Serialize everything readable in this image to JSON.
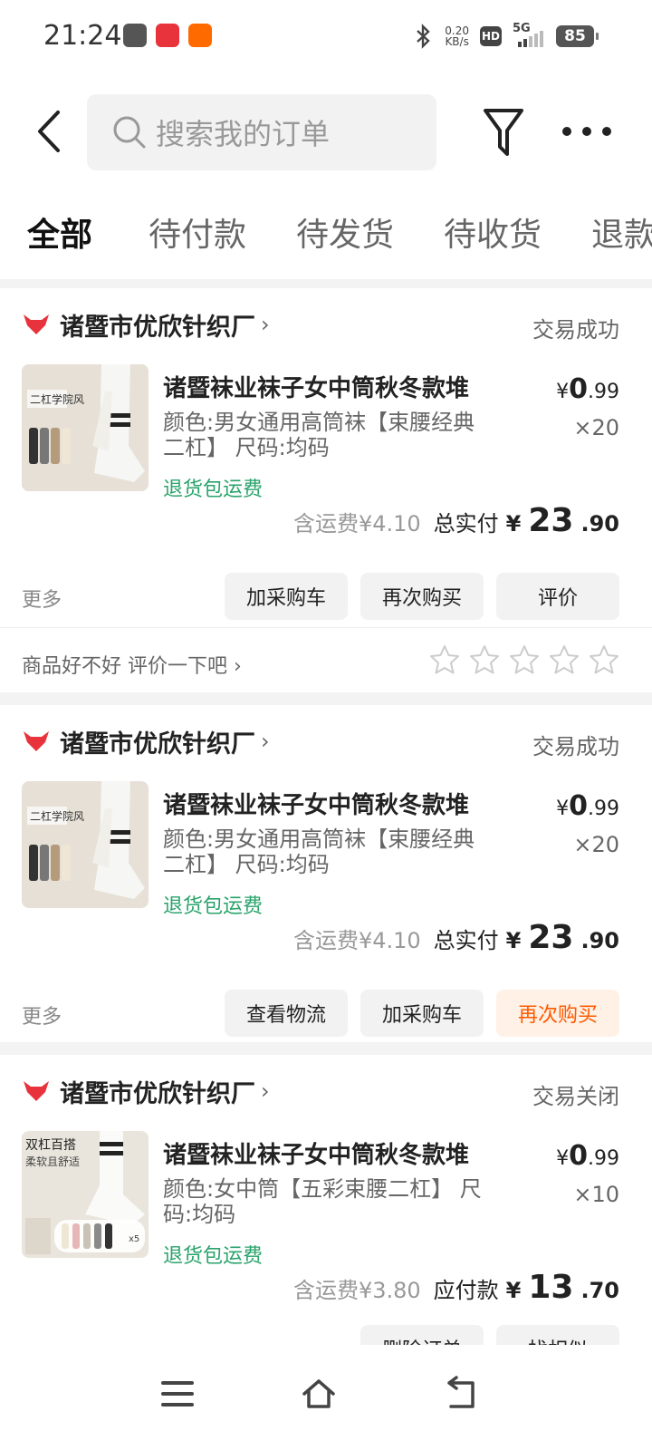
{
  "status_bar": {
    "time": "21:24",
    "net_speed_value": "0.20",
    "net_speed_unit": "KB/s",
    "hd": "HD",
    "network": "5G",
    "battery": "85",
    "colors": {
      "app1": "#555555",
      "app2": "#e8323c",
      "app3": "#ff6a00"
    }
  },
  "header": {
    "search_placeholder": "搜索我的订单",
    "icons": {
      "back": "chevron-left-icon",
      "search": "search-icon",
      "filter": "filter-icon",
      "more": "more-dots-icon"
    }
  },
  "tabs": [
    {
      "label": "全部",
      "active": true
    },
    {
      "label": "待付款"
    },
    {
      "label": "待发货"
    },
    {
      "label": "待收货"
    },
    {
      "label": "退款"
    }
  ],
  "orders": [
    {
      "shop": "诸暨市优欣针织厂",
      "status": "交易成功",
      "title": "诸暨袜业袜子女中筒秋冬款堆",
      "spec": "颜色:男女通用高筒袜【束腰经典二杠】 尺码:均码",
      "free_return": "退货包运费",
      "price_symbol": "¥",
      "price_int": "0",
      "price_dec": ".99",
      "qty": "×20",
      "shipping": "含运费¥4.10",
      "total_label": "总实付",
      "total_symbol": "¥",
      "total_int": "23",
      "total_dec": ".90",
      "more": "更多",
      "buttons": [
        "加采购车",
        "再次购买",
        "评价"
      ],
      "rate_text": "商品好不好 评价一下吧",
      "stars_selected": 0,
      "stars_total": 5,
      "thumb_text": "二杠学院风"
    },
    {
      "shop": "诸暨市优欣针织厂",
      "status": "交易成功",
      "title": "诸暨袜业袜子女中筒秋冬款堆",
      "spec": "颜色:男女通用高筒袜【束腰经典二杠】 尺码:均码",
      "free_return": "退货包运费",
      "price_symbol": "¥",
      "price_int": "0",
      "price_dec": ".99",
      "qty": "×20",
      "shipping": "含运费¥4.10",
      "total_label": "总实付",
      "total_symbol": "¥",
      "total_int": "23",
      "total_dec": ".90",
      "more": "更多",
      "buttons": [
        "查看物流",
        "加采购车",
        "再次购买"
      ],
      "thumb_text": "二杠学院风"
    },
    {
      "shop": "诸暨市优欣针织厂",
      "status": "交易关闭",
      "title": "诸暨袜业袜子女中筒秋冬款堆",
      "spec": "颜色:女中筒【五彩束腰二杠】 尺码:均码",
      "free_return": "退货包运费",
      "price_symbol": "¥",
      "price_int": "0",
      "price_dec": ".99",
      "qty": "×10",
      "shipping": "含运费¥3.80",
      "total_label": "应付款",
      "total_symbol": "¥",
      "total_int": "13",
      "total_dec": ".70",
      "buttons": [
        "删除订单",
        "找相似"
      ],
      "thumb_text": "双杠百搭",
      "thumb_text2": "柔软且舒适",
      "thumb_badge": "x5"
    }
  ],
  "bottom_nav": {
    "icons": [
      "menu-icon",
      "home-icon",
      "back-icon"
    ]
  },
  "accent_colors": {
    "brand": "#ff5a00",
    "green": "#2aa36b",
    "shop_logo": "#e8323c"
  }
}
